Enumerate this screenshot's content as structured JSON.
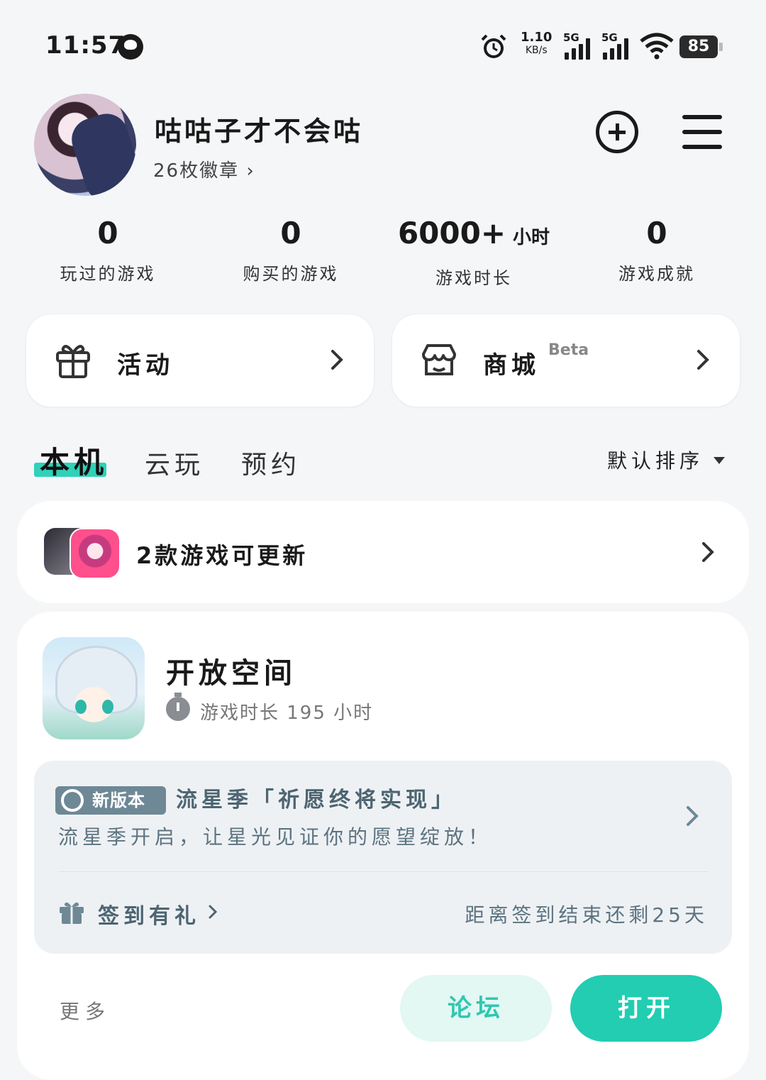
{
  "status_bar": {
    "time": "11:57",
    "net_speed": "1.10",
    "net_unit": "KB/s",
    "sim1": "5G",
    "sim2": "5G",
    "battery": "85"
  },
  "profile": {
    "username": "咕咕子才不会咕",
    "badges": "26枚徽章 ›"
  },
  "stats": [
    {
      "value": "0",
      "suffix": "",
      "label": "玩过的游戏"
    },
    {
      "value": "0",
      "suffix": "",
      "label": "购买的游戏"
    },
    {
      "value": "6000+",
      "suffix": "小时",
      "label": "游戏时长"
    },
    {
      "value": "0",
      "suffix": "",
      "label": "游戏成就"
    }
  ],
  "quick_links": {
    "activity": "活动",
    "store": "商城",
    "store_tag": "Beta"
  },
  "tabs": [
    "本机",
    "云玩",
    "预约"
  ],
  "sort_label": "默认排序",
  "update_banner": "2款游戏可更新",
  "game": {
    "title": "开放空间",
    "play_time": "游戏时长 195 小时",
    "news_badge": "新版本",
    "news_title": "流星季「祈愿终将实现」",
    "news_desc": "流星季开启，让星光见证你的愿望绽放！",
    "signin": "签到有礼",
    "remain": "距离签到结束还剩25天",
    "more": "更多",
    "forum": "论坛",
    "open": "打开"
  },
  "colors": {
    "accent": "#22cdb2",
    "accent_light": "#e3f7f3",
    "news_text": "#4d6572"
  },
  "icons": [
    "qq-icon",
    "alarm-icon",
    "wifi-icon",
    "signal-icon",
    "add-icon",
    "menu-icon",
    "gift-icon",
    "store-icon",
    "chevron-right-icon",
    "timer-icon",
    "update-icon",
    "sort-arrow-icon"
  ]
}
